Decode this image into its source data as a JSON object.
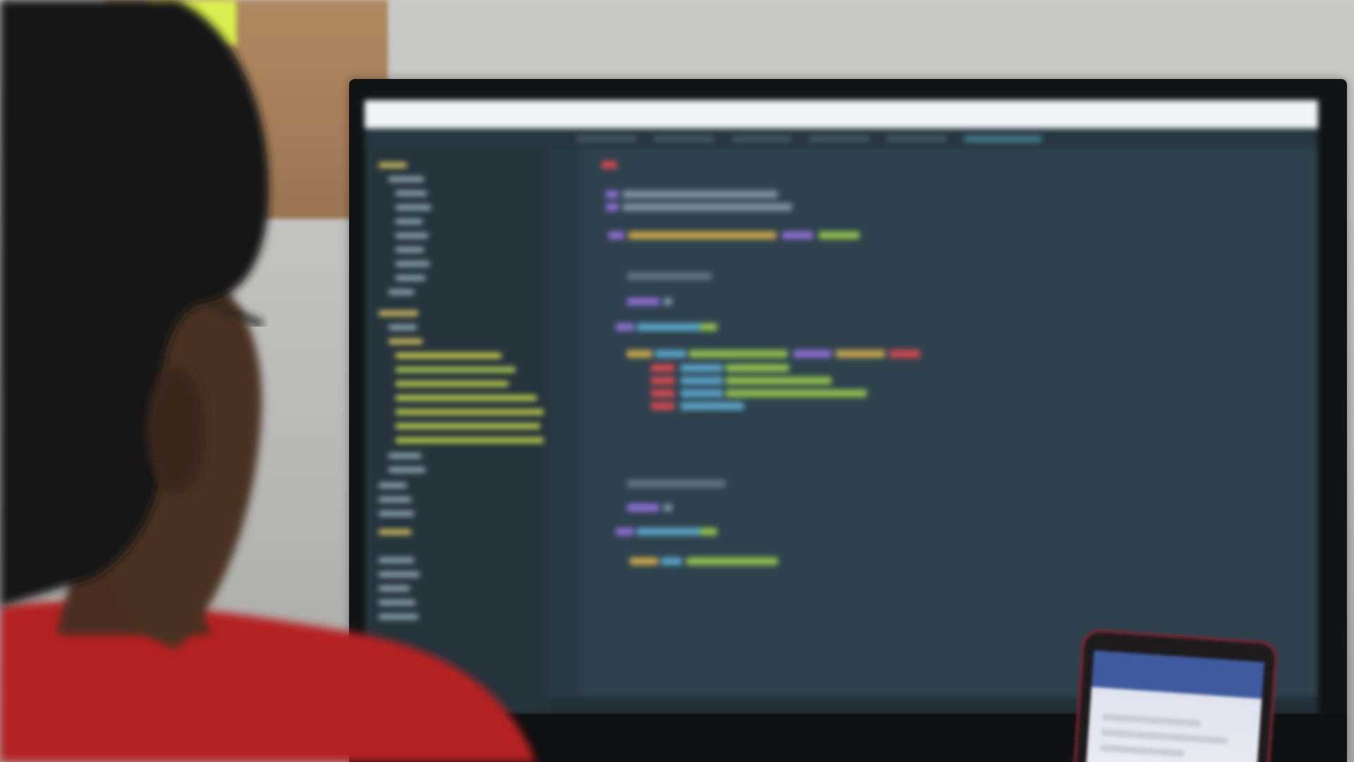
{
  "scene": {
    "subject": "person-viewing-code-editor",
    "icons": [
      "person-silhouette-icon",
      "monitor-icon",
      "smartphone-icon"
    ]
  },
  "colors": {
    "editor_background": "#2e414d",
    "sidebar_background": "#26343d",
    "shirt": "#b52222",
    "phone_accent": "#7a2631",
    "wall": "#c9c9c7"
  }
}
